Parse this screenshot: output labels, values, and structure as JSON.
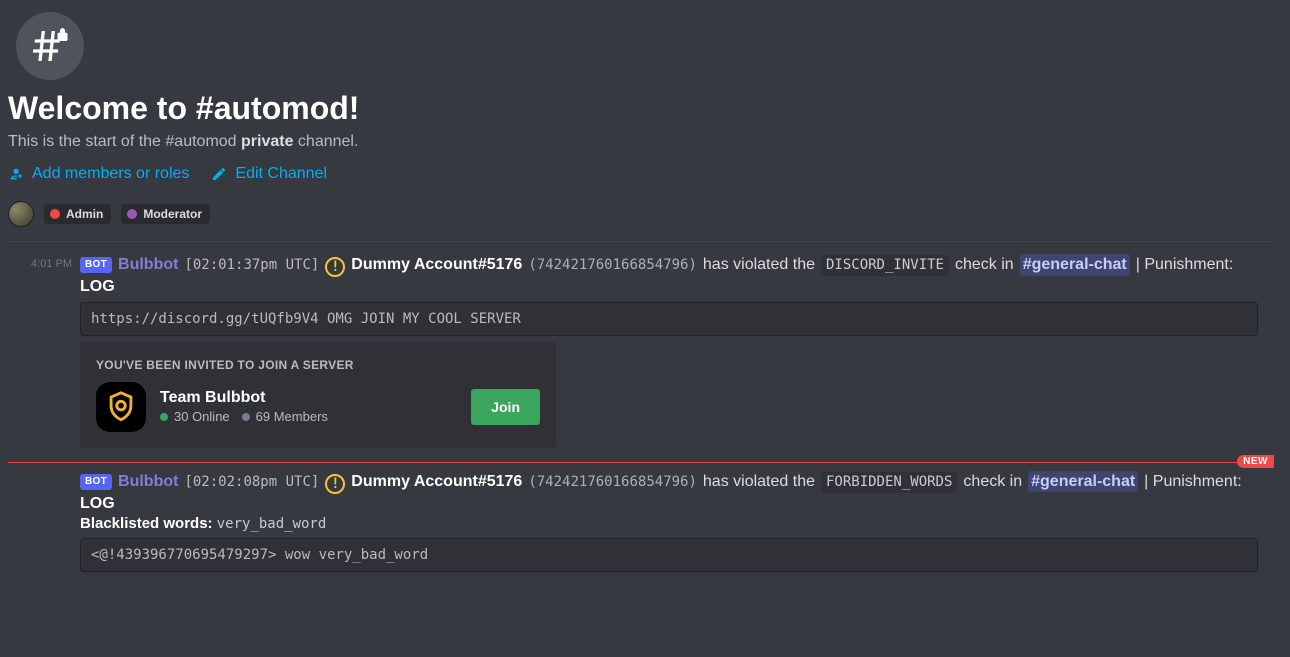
{
  "welcome": {
    "title": "Welcome to #automod!",
    "desc_prefix": "This is the start of the #automod ",
    "desc_bold": "private",
    "desc_suffix": " channel."
  },
  "actions": {
    "add_members": "Add members or roles",
    "edit_channel": "Edit Channel"
  },
  "roles": [
    {
      "color": "#f04747",
      "label": "Admin"
    },
    {
      "color": "#9b59b6",
      "label": "Moderator"
    }
  ],
  "new_divider_label": "NEW",
  "messages": [
    {
      "ts": "4:01 PM",
      "bot_tag": "BOT",
      "bot_name": "Bulbbot",
      "utc": "[02:01:37pm UTC]",
      "violator": "Dummy Account#5176",
      "user_id": "(742421760166854796)",
      "t_violated": "has violated the",
      "check": "DISCORD_INVITE",
      "t_checkin": "check in",
      "channel": "#general-chat",
      "t_punish": " | Punishment:",
      "log_label": "LOG",
      "codeblock": "https://discord.gg/tUQfb9V4 OMG JOIN MY COOL SERVER",
      "invite": {
        "header": "YOU'VE BEEN INVITED TO JOIN A SERVER",
        "server_name": "Team Bulbbot",
        "online": "30 Online",
        "members": "69 Members",
        "join": "Join"
      }
    },
    {
      "ts": "",
      "bot_tag": "BOT",
      "bot_name": "Bulbbot",
      "utc": "[02:02:08pm UTC]",
      "violator": "Dummy Account#5176",
      "user_id": "(742421760166854796)",
      "t_violated": "has violated the",
      "check": "FORBIDDEN_WORDS",
      "t_checkin": "check in",
      "channel": "#general-chat",
      "t_punish": " | Punishment:",
      "log_label": "LOG",
      "blacklist_label": "Blacklisted words:",
      "blacklist_words": "very_bad_word",
      "codeblock": "<@!439396770695479297> wow very_bad_word"
    }
  ]
}
